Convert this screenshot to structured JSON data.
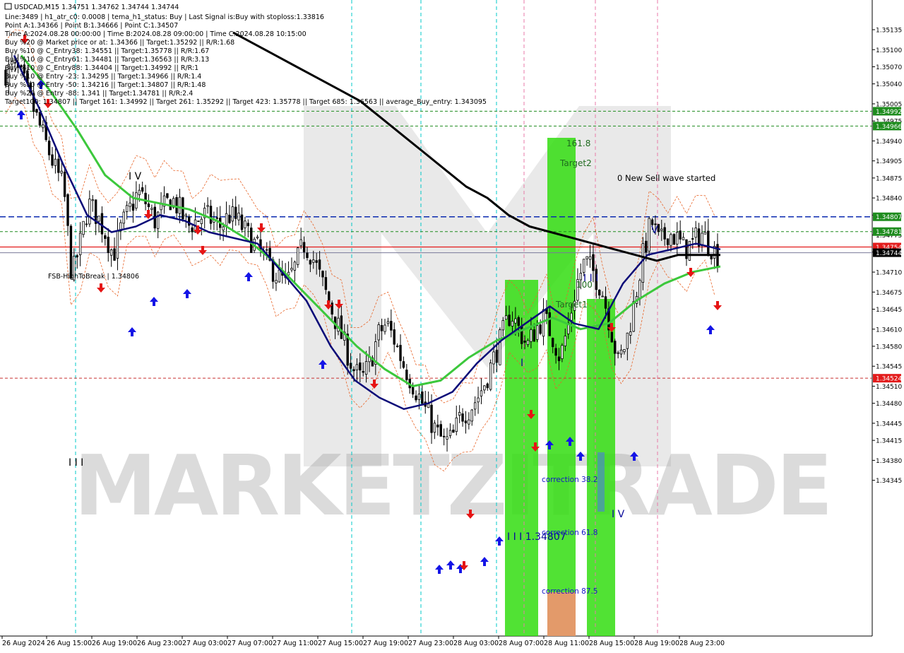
{
  "header": {
    "symbol_line": "USDCAD,M15  1.34751 1.34762 1.34744 1.34744",
    "info_lines": [
      "Line:3489 | h1_atr_c0: 0.0008 | tema_h1_status: Buy | Last Signal is:Buy with stoploss:1.33816",
      "Point A:1.34366 | Point B:1.34666 | Point C:1.34507",
      "Time A:2024.08.28 00:00:00 | Time B:2024.08.28 09:00:00 | Time C:2024.08.28 10:15:00",
      "Buy %20 @ Market price or at: 1.34366 || Target:1.35292 || R/R:1.68",
      "Buy %10 @ C_Entry38: 1.34551 || Target:1.35778 || R/R:1.67",
      "Buy %10 @ C_Entry61: 1.34481 || Target:1.36563 || R/R:3.13",
      "Buy %10 @ C_Entry88: 1.34404 || Target:1.34992 || R/R:1",
      "Buy %10 @ Entry -23: 1.34295 || Target:1.34966 || R/R:1.4",
      "Buy %10 @ Entry -50: 1.34216 || Target:1.34807 || R/R:1.48",
      "Buy %20 @ Entry -88: 1.341 || Target:1.34781 || R/R:2.4",
      "Target100: 1.34807 || Target 161: 1.34992 || Target 261: 1.35292 || Target 423: 1.35778 || Target 685: 1.36563 || average_Buy_entry: 1.343095"
    ]
  },
  "watermark": "MARKETZITRADE",
  "annotations": {
    "wave_iv": "I V",
    "wave_iii": "I I I",
    "wave_iii_price": "I I I 1.34807",
    "wave_v": "V",
    "wave_i": "I",
    "wave_iii_b": "I I I",
    "wave_iv_b": "I V",
    "fib_161": "161.8",
    "target2": "Target2",
    "fib_100": "100",
    "target1": "Target1",
    "new_sell_wave": "0 New Sell wave started",
    "fsb_label": "FSB-HighToBreak | 1.34806",
    "correction_38": "correction 38.2",
    "correction_61": "correction 61.8",
    "correction_87": "correction 87.5"
  },
  "price_labels": [
    {
      "price": 1.34992,
      "label": "1.34992",
      "color": "#1e8c1e"
    },
    {
      "price": 1.34966,
      "label": "1.34966",
      "color": "#1e8c1e"
    },
    {
      "price": 1.34807,
      "label": "1.34807",
      "color": "#1e8c1e"
    },
    {
      "price": 1.34781,
      "label": "1.34781",
      "color": "#1e8c1e"
    },
    {
      "price": 1.34754,
      "label": "1.34754",
      "color": "#e31b1b"
    },
    {
      "price": 1.34744,
      "label": "1.34744",
      "color": "#000000"
    },
    {
      "price": 1.34524,
      "label": "1.34524",
      "color": "#e31b1b"
    }
  ],
  "colors": {
    "bull": "#000000",
    "bear": "#000000",
    "ma_slow": "#000000",
    "ma_mid": "#0a0a78",
    "ma_green": "#3cc83c",
    "green_zone": "#33dd11",
    "orange_zone": "#e39a6a",
    "buy_arrow": "#1414e6",
    "sell_arrow": "#e61414",
    "target_line": "#1e8c1e",
    "fsb_line": "#0b2bb0",
    "time_marker": "#00c8c8",
    "pink_marker": "#e87aa8"
  },
  "chart_data": {
    "type": "candlestick",
    "symbol": "USDCAD",
    "timeframe": "M15",
    "ohlc_last": {
      "open": 1.34751,
      "high": 1.34762,
      "low": 1.34744,
      "close": 1.34744
    },
    "y_ticks": [
      1.35135,
      1.351,
      1.3507,
      1.3504,
      1.35005,
      1.34975,
      1.3494,
      1.34905,
      1.34875,
      1.3484,
      1.3481,
      1.34775,
      1.34745,
      1.3471,
      1.34675,
      1.34645,
      1.3461,
      1.3458,
      1.34545,
      1.3451,
      1.3448,
      1.34445,
      1.34415,
      1.3438,
      1.34345
    ],
    "x_labels": [
      "26 Aug 2024",
      "26 Aug 15:00",
      "26 Aug 19:00",
      "26 Aug 23:00",
      "27 Aug 03:00",
      "27 Aug 07:00",
      "27 Aug 11:00",
      "27 Aug 15:00",
      "27 Aug 19:00",
      "27 Aug 23:00",
      "28 Aug 03:00",
      "28 Aug 07:00",
      "28 Aug 11:00",
      "28 Aug 15:00",
      "28 Aug 19:00",
      "28 Aug 23:00"
    ],
    "close_path": [
      1.3506,
      1.3507,
      1.3505,
      1.3501,
      1.3497,
      1.3493,
      1.3489,
      1.3486,
      1.347,
      1.3476,
      1.3483,
      1.3481,
      1.3478,
      1.3474,
      1.3479,
      1.3482,
      1.3485,
      1.3483,
      1.348,
      1.3482,
      1.3484,
      1.3482,
      1.3479,
      1.348,
      1.3481,
      1.348,
      1.3479,
      1.3481,
      1.348,
      1.3478,
      1.3476,
      1.3474,
      1.3472,
      1.347,
      1.3469,
      1.3472,
      1.3476,
      1.3474,
      1.347,
      1.3466,
      1.3462,
      1.3458,
      1.3454,
      1.3452,
      1.3455,
      1.346,
      1.3462,
      1.3459,
      1.3455,
      1.3452,
      1.3449,
      1.3446,
      1.3443,
      1.3441,
      1.3442,
      1.3446,
      1.3447,
      1.3449,
      1.3452,
      1.3456,
      1.346,
      1.3464,
      1.3461,
      1.3458,
      1.3461,
      1.3463,
      1.346,
      1.3456,
      1.3462,
      1.3469,
      1.3473,
      1.3471,
      1.3468,
      1.3462,
      1.3455,
      1.3459,
      1.3466,
      1.3474,
      1.348,
      1.3476,
      1.3478,
      1.3477,
      1.3475,
      1.3476,
      1.3478,
      1.3476,
      1.3474
    ],
    "ma_slow": [
      1.3513,
      1.3511,
      1.3509,
      1.3507,
      1.3505,
      1.3503,
      1.3501,
      1.3498,
      1.3495,
      1.3492,
      1.3489,
      1.3486,
      1.3484,
      1.3481,
      1.3479,
      1.3478,
      1.3477,
      1.3476,
      1.3475,
      1.3474,
      1.3473,
      1.3474,
      1.3474,
      1.3474
    ],
    "ma_mid": [
      1.3509,
      1.35,
      1.349,
      1.3481,
      1.3478,
      1.3479,
      1.3481,
      1.348,
      1.3478,
      1.3477,
      1.3476,
      1.3471,
      1.3466,
      1.3458,
      1.3452,
      1.3449,
      1.3447,
      1.3448,
      1.345,
      1.3455,
      1.3459,
      1.3462,
      1.3465,
      1.3462,
      1.3461,
      1.3469,
      1.3474,
      1.3475,
      1.3476,
      1.3475
    ],
    "ma_green": [
      1.3509,
      1.3503,
      1.3496,
      1.3488,
      1.3484,
      1.3483,
      1.3482,
      1.348,
      1.3477,
      1.3473,
      1.3468,
      1.3463,
      1.3458,
      1.3454,
      1.3451,
      1.3452,
      1.3456,
      1.3459,
      1.3461,
      1.3463,
      1.3461,
      1.3462,
      1.3466,
      1.3469,
      1.3471,
      1.3472
    ]
  }
}
